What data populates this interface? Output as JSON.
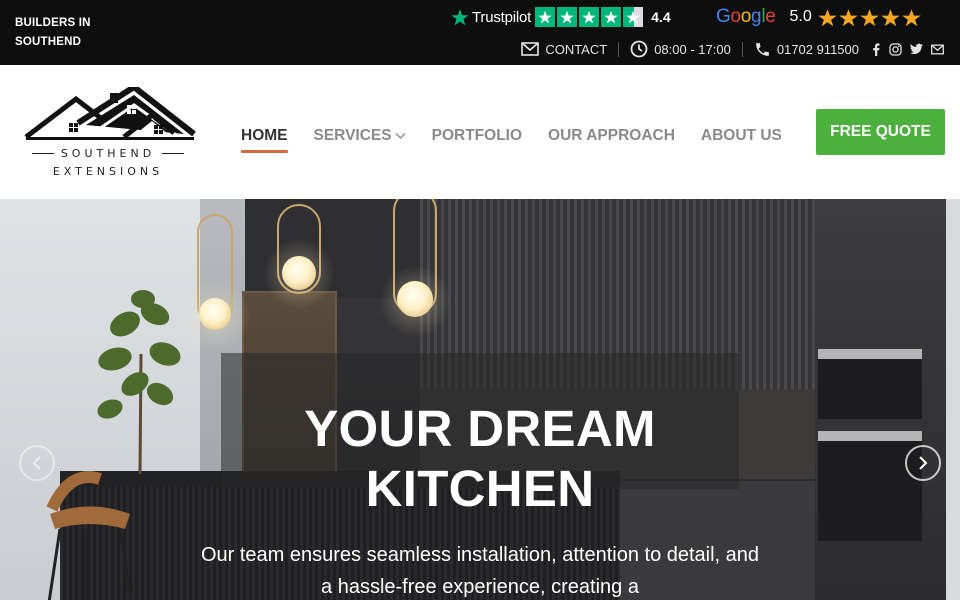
{
  "topbar": {
    "tagline": "BUILDERS IN SOUTHEND",
    "trustpilot": {
      "name": "Trustpilot",
      "score": "4.4",
      "stars": 4.5
    },
    "google": {
      "name": "Google",
      "score": "5.0",
      "stars": 5
    },
    "contact_label": "CONTACT",
    "hours": "08:00 - 17:00",
    "phone": "01702 911500",
    "social_icons": [
      "facebook-icon",
      "instagram-icon",
      "twitter-icon",
      "email-icon"
    ]
  },
  "logo": {
    "line1": "SOUTHEND",
    "line2": "EXTENSIONS"
  },
  "nav": {
    "items": [
      {
        "label": "HOME",
        "active": true
      },
      {
        "label": "SERVICES",
        "dropdown": true
      },
      {
        "label": "PORTFOLIO"
      },
      {
        "label": "OUR APPROACH"
      },
      {
        "label": "ABOUT US"
      }
    ],
    "cta": "FREE QUOTE"
  },
  "hero": {
    "title_line1": "YOUR DREAM",
    "title_line2": "KITCHEN",
    "text": "Our team ensures seamless installation, attention to detail, and a hassle-free experience, creating a"
  },
  "colors": {
    "topbar_bg": "#0e0e0e",
    "trustpilot_green": "#00b67a",
    "google_star": "#f5a623",
    "nav_active_underline": "#d6693f",
    "cta_green": "#4caf3e"
  }
}
